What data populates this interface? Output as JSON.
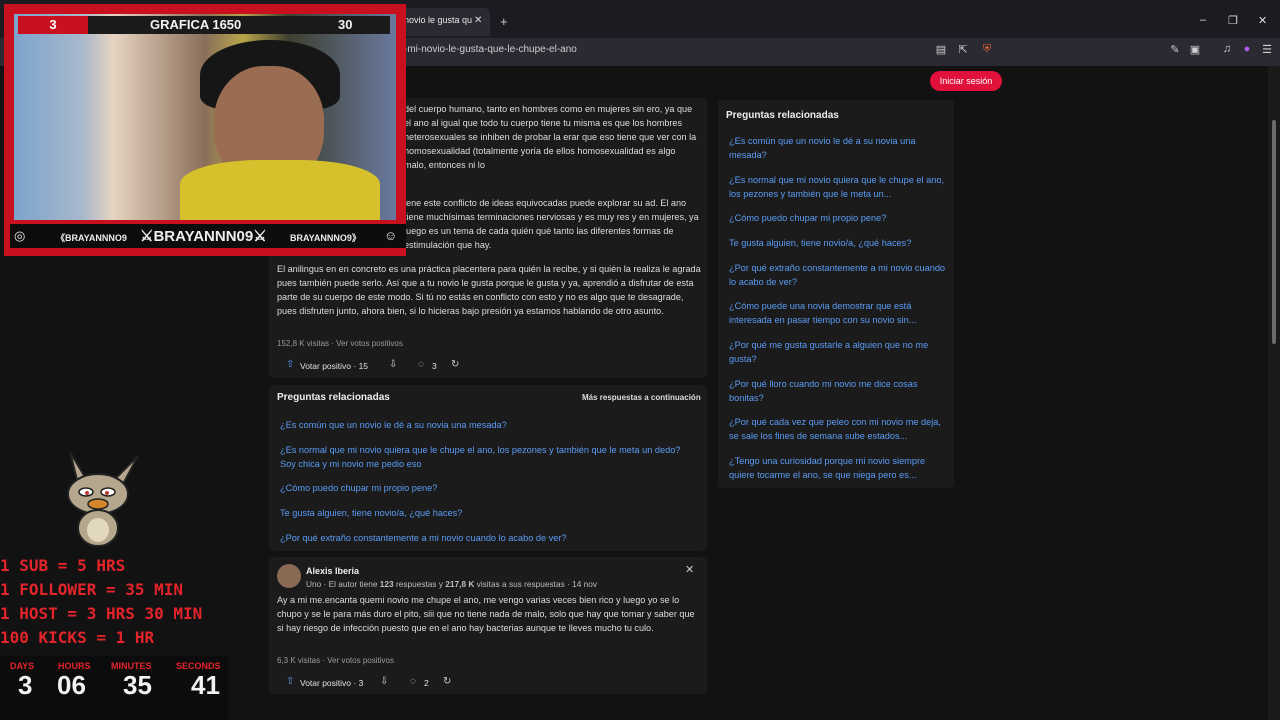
{
  "browser": {
    "tab_title": "novio le gusta qu",
    "url": "-mi-novio-le-gusta-que-le-chupe-el-ano",
    "close_glyph": "✕",
    "new_tab_glyph": "+",
    "min_glyph": "–",
    "max_glyph": "❐",
    "win_close_glyph": "✕"
  },
  "header": {
    "login_label": "Iniciar sesión"
  },
  "answer1": {
    "para1": "del cuerpo humano, tanto en hombres como en mujeres sin ero, ya que el ano al igual que todo tu cuerpo tiene tu misma es que los hombres heterosexuales se inhiben de probar la erar que eso tiene que ver con la homosexualidad (totalmente yoría de ellos homosexualidad es algo malo, entonces ni lo",
    "para2": "iene este conflicto de ideas equivocadas puede explorar su ad. El ano tiene muchísimas terminaciones nerviosas y es muy res y en mujeres, ya luego es un tema de cada quién qué tanto las diferentes formas de estimulación que hay.",
    "para3": "El anilingus en en concreto es una práctica placentera para quién la recibe, y si quién la realiza le agrada pues también puede serlo. Así que a tu novio le gusta porque le gusta y ya, aprendió a disfrutar de esta parte de su cuerpo de este modo. Si tú no estás en conflicto con esto y no es algo que te desagrade, pues disfruten junto, ahora bien, si lo hicieras bajo presión ya estamos hablando de otro asunto.",
    "views": "152,8 K visitas · Ver votos positivos",
    "upvote_label": "Votar positivo · 15",
    "comments": "3"
  },
  "related_inline": {
    "title": "Preguntas relacionadas",
    "more": "Más respuestas a continuación",
    "links": [
      "¿Es común que un novio le dé a su novia una mesada?",
      "¿Es normal que mi novio quiera que le chupe el ano, los pezones y también que le meta un dedo? Soy chica y mi novio me pedio eso",
      "¿Cómo puedo chupar mi propio pene?",
      "Te gusta alguien, tiene novio/a, ¿qué haces?",
      "¿Por qué extraño constantemente a mi novio cuando lo acabo de ver?"
    ]
  },
  "answer2": {
    "author": "Alexis Iberia",
    "meta_pre": "Uno · El autor tiene ",
    "meta_answers": "123",
    "meta_mid": " respuestas y ",
    "meta_views": "217,8 K",
    "meta_post": " visitas a sus respuestas · 14 nov",
    "body": "Ay a mi me.encanta quemi novio me chupe el ano, me vengo varias veces bien rico y luego yo se lo chupo y se le para más duro el pito, siii que no tiene nada de malo, solo que hay que tomar y saber que si hay riesgo de infección puesto que en el ano hay bacterias aunque te lleves mucho tu culo.",
    "views": "6,3 K visitas · Ver votos positivos",
    "upvote_label": "Votar positivo · 3",
    "comments": "2"
  },
  "sidebar": {
    "title": "Preguntas relacionadas",
    "links": [
      "¿Es común que un novio le dé a su novia una mesada?",
      "¿Es normal que mi novio quiera que le chupe el ano, los pezones y también que le meta un...",
      "¿Cómo puedo chupar mi propio pene?",
      "Te gusta alguien, tiene novio/a, ¿qué haces?",
      "¿Por qué extraño constantemente a mi novio cuando lo acabo de ver?",
      "¿Cómo puede una novia demostrar que está interesada en pasar tiempo con su novio sin...",
      "¿Por qué me gusta gustarle a alguien que no me gusta?",
      "¿Por qué lloro cuando mi novio me dice cosas bonitas?",
      "¿Por qué cada vez que peleo con mi novio me deja, se sale los fines de semana sube estados...",
      "¿Tengo una curiosidad porque mi novio siempre quiere tocarme el ano, se que niega pero es..."
    ]
  },
  "stream": {
    "left_num": "3",
    "title": "GRAFICA 1650",
    "right_num": "30",
    "handle_small": "《BRAYANNNO9",
    "handle_big": "⚔BRAYANNN09⚔",
    "handle_small2": "BRAYANNNO9》",
    "rules": [
      "1 SUB = 5 HRS",
      "1 FOLLOWER = 35 MIN",
      "1 HOST = 3 HRS 30 MIN",
      "100 KICKS = 1 HR"
    ],
    "timer_labels": [
      "DAYS",
      "HOURS",
      "MINUTES",
      "SECONDS"
    ],
    "timer_values": [
      "3",
      "06",
      "35",
      "41"
    ]
  }
}
